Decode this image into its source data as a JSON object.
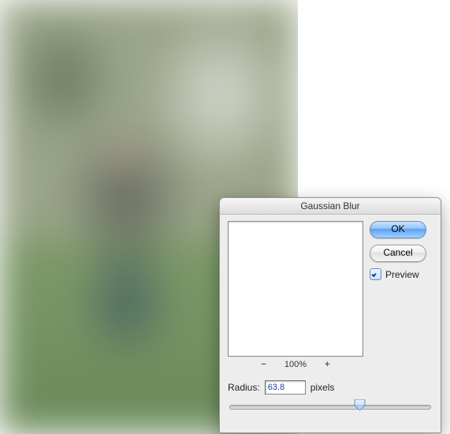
{
  "dialog": {
    "title": "Gaussian Blur",
    "ok_label": "OK",
    "cancel_label": "Cancel",
    "preview_label": "Preview",
    "preview_checked": true,
    "zoom": {
      "minus": "−",
      "value": "100%",
      "plus": "+"
    },
    "radius": {
      "label": "Radius:",
      "value": "63.8",
      "unit": "pixels",
      "slider_min": 0.1,
      "slider_max": 100,
      "slider_pos_percent": 63
    }
  }
}
